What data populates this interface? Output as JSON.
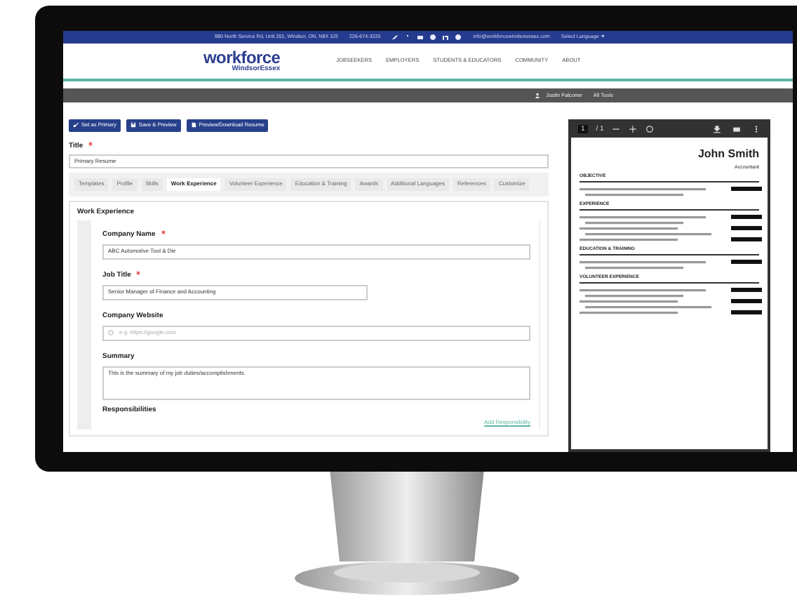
{
  "top_bar": {
    "address": "880 North Service Rd, Unit 201, Windsor, ON, N8X 3J3",
    "phone": "226-674-3220",
    "email": "info@workforcewindsoressex.com",
    "language": "Select Language ▼"
  },
  "logo": {
    "name": "workforce",
    "subtitle": "WindsorEssex"
  },
  "nav": [
    {
      "label": "JOBSEEKERS"
    },
    {
      "label": "EMPLOYERS"
    },
    {
      "label": "STUDENTS & EDUCATORS"
    },
    {
      "label": "COMMUNITY"
    },
    {
      "label": "ABOUT"
    }
  ],
  "user_bar": {
    "user": "Justin Falconer",
    "tools": "All Tools"
  },
  "actions": [
    {
      "label": "Set as Primary",
      "kind": "key"
    },
    {
      "label": "Save & Preview",
      "kind": "save"
    },
    {
      "label": "Preview/Download Resume",
      "kind": "file"
    }
  ],
  "title_field": {
    "label": "Title",
    "required": true,
    "value": "Primary Resume"
  },
  "tabs": [
    {
      "label": "Templates",
      "selected": false
    },
    {
      "label": "Profile",
      "selected": false
    },
    {
      "label": "Skills",
      "selected": false
    },
    {
      "label": "Work Experience",
      "selected": true
    },
    {
      "label": "Volunteer Experience",
      "selected": false
    },
    {
      "label": "Education & Training",
      "selected": false
    },
    {
      "label": "Awards",
      "selected": false
    },
    {
      "label": "Additional Languages",
      "selected": false
    },
    {
      "label": "References",
      "selected": false
    },
    {
      "label": "Customize",
      "selected": false
    }
  ],
  "section": {
    "title": "Work Experience",
    "fields": [
      {
        "kind": "input",
        "label": "Company Name",
        "required": true,
        "value": "ABC Automotive Tool & Die"
      },
      {
        "kind": "short",
        "label": "Job Title",
        "required": true,
        "value": "Senior Manager of Finance and Accounting"
      },
      {
        "kind": "url",
        "label": "Company Website",
        "required": false,
        "placeholder": "e.g. https://google.com"
      },
      {
        "kind": "textarea",
        "label": "Summary",
        "required": false,
        "value": "This is the summary of my job duties/accomplishments."
      }
    ],
    "responsibilities": "Responsibilities",
    "add_link": "Add Responsibility"
  },
  "pdf": {
    "page": "1",
    "total": "/ 1",
    "name": "John Smith",
    "role": "Accountant",
    "headings": [
      "OBJECTIVE",
      "EXPERIENCE",
      "EDUCATION & TRAINING",
      "VOLUNTEER EXPERIENCE"
    ]
  }
}
